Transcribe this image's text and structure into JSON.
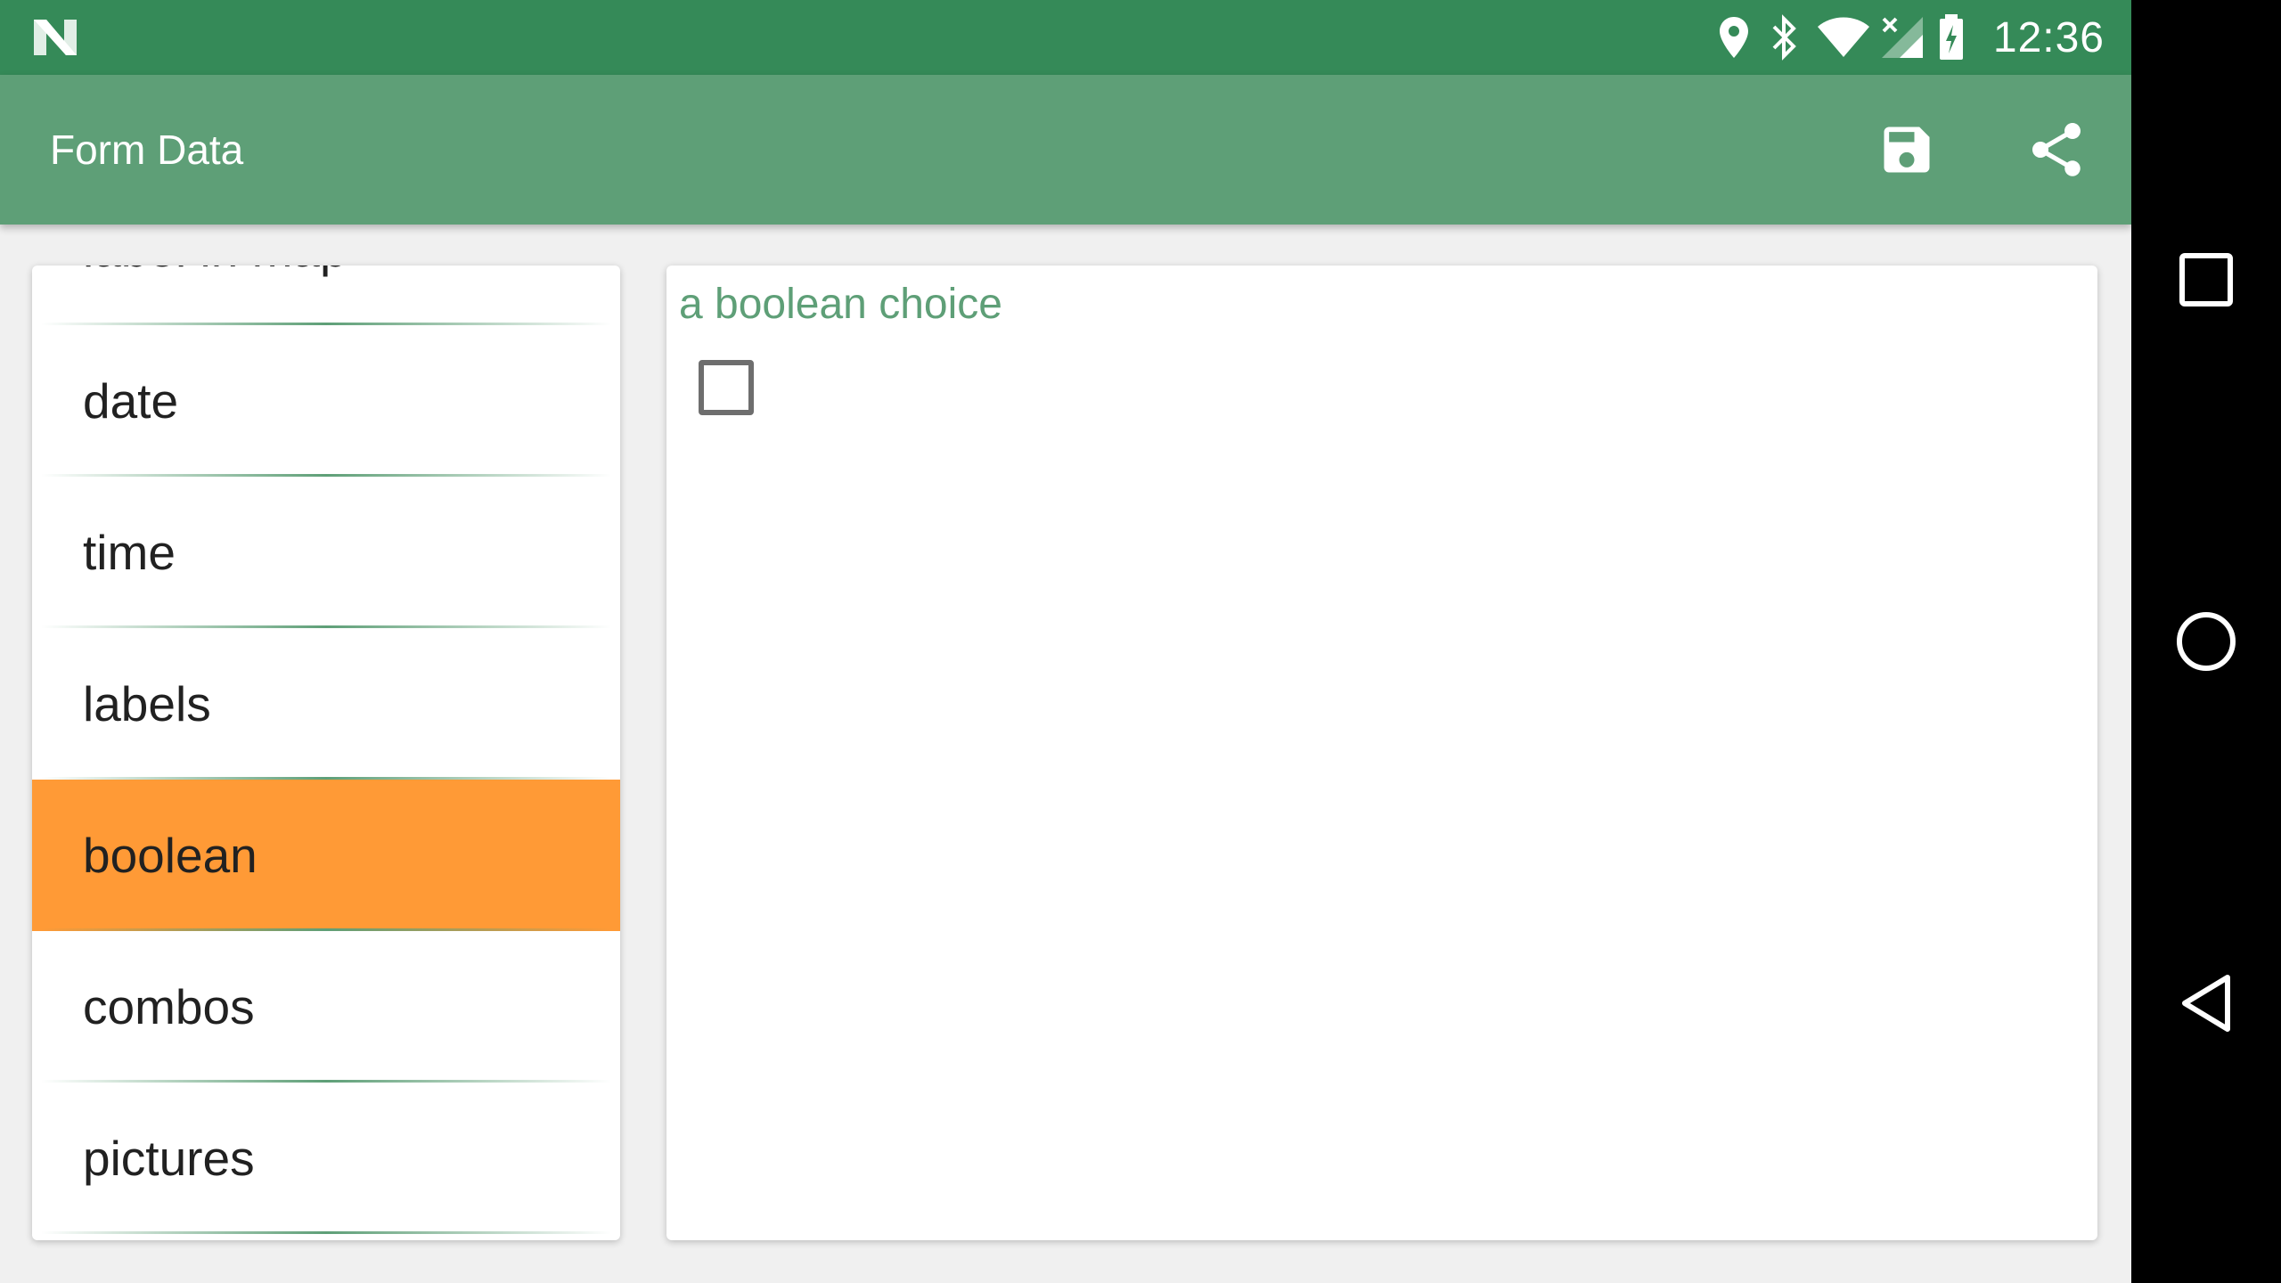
{
  "status_bar": {
    "time": "12:36",
    "icons": [
      "notification-n-icon",
      "location-icon",
      "bluetooth-icon",
      "wifi-icon",
      "cell-signal-icon",
      "battery-charging-icon"
    ]
  },
  "app_bar": {
    "title": "Form Data",
    "actions": [
      "save-icon",
      "share-icon"
    ]
  },
  "sections_list": {
    "items": [
      {
        "label": "label in map"
      },
      {
        "label": "date"
      },
      {
        "label": "time"
      },
      {
        "label": "labels"
      },
      {
        "label": "boolean"
      },
      {
        "label": "combos"
      },
      {
        "label": "pictures"
      }
    ],
    "selected": "boolean"
  },
  "form": {
    "field_label": "a boolean choice",
    "checkbox_checked": false
  },
  "nav_bar": {
    "buttons": [
      "recents-icon",
      "home-icon",
      "back-icon"
    ]
  },
  "colors": {
    "status_bar": "#358a58",
    "app_bar": "#5e9f77",
    "selected_item": "#ff9a36",
    "accent_text": "#5e9f77"
  }
}
